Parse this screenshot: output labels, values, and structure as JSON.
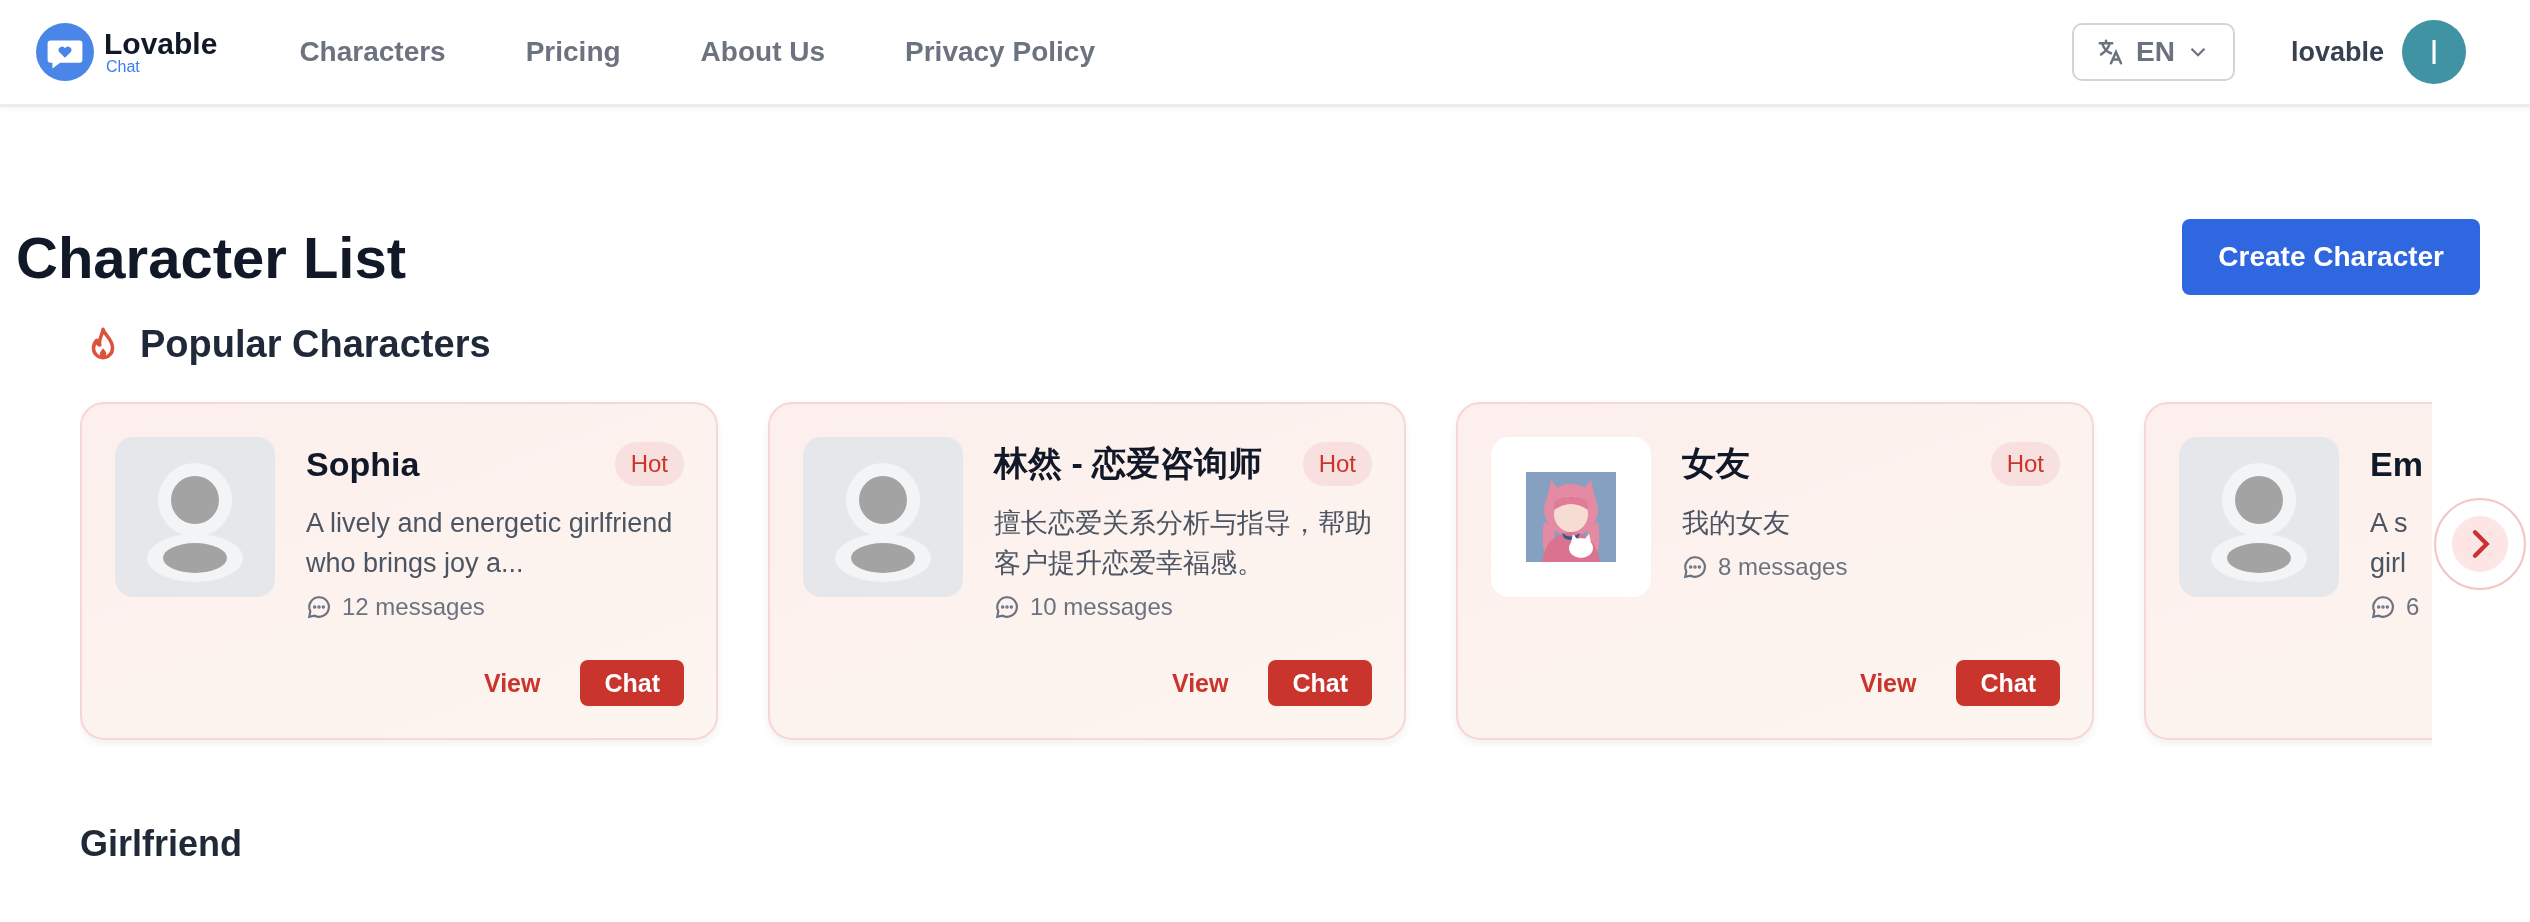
{
  "header": {
    "logo": {
      "name": "Lovable",
      "sub": "Chat"
    },
    "nav": [
      "Characters",
      "Pricing",
      "About Us",
      "Privacy Policy"
    ],
    "language": "EN",
    "username": "lovable",
    "avatar_initial": "l"
  },
  "page_title": "Character List",
  "create_button": "Create Character",
  "popular": {
    "heading": "Popular Characters",
    "cards": [
      {
        "name": "Sophia",
        "badge": "Hot",
        "description": "A lively and energetic girlfriend who brings joy a...",
        "messages": "12 messages",
        "kind": "placeholder",
        "view": "View",
        "chat": "Chat"
      },
      {
        "name": "林然 - 恋爱咨询师",
        "badge": "Hot",
        "description": "擅长恋爱关系分析与指导，帮助客户提升恋爱幸福感。",
        "messages": "10 messages",
        "kind": "placeholder",
        "view": "View",
        "chat": "Chat"
      },
      {
        "name": "女友",
        "badge": "Hot",
        "description": "我的女友",
        "messages": "8 messages",
        "kind": "picture",
        "view": "View",
        "chat": "Chat"
      },
      {
        "name": "Em",
        "description": "A s girl",
        "messages": "6",
        "kind": "placeholder"
      }
    ]
  },
  "section_heading": "Girlfriend"
}
